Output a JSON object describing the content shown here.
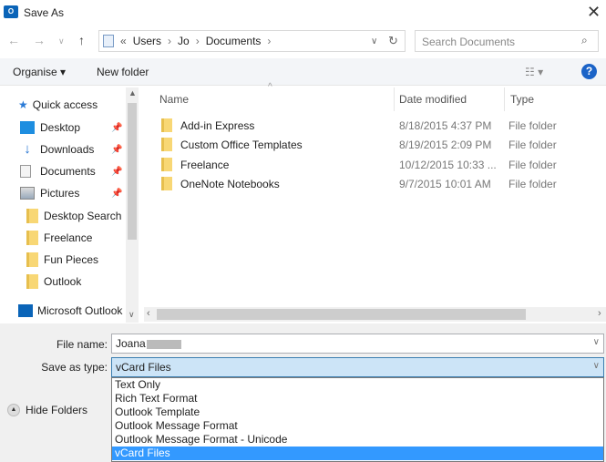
{
  "window": {
    "title": "Save As",
    "app_icon": "O"
  },
  "address": {
    "prefix": "«",
    "crumbs": [
      "Users",
      "Jo",
      "Documents"
    ]
  },
  "search": {
    "placeholder": "Search Documents"
  },
  "toolbar": {
    "organise": "Organise ▾",
    "new_folder": "New folder",
    "help": "?"
  },
  "sidebar": {
    "items": [
      {
        "label": "Quick access",
        "icon": "star-icon"
      },
      {
        "label": "Desktop",
        "icon": "desktop-icon",
        "pinned": true
      },
      {
        "label": "Downloads",
        "icon": "download-icon",
        "pinned": true
      },
      {
        "label": "Documents",
        "icon": "document-icon",
        "pinned": true
      },
      {
        "label": "Pictures",
        "icon": "pictures-icon",
        "pinned": true
      },
      {
        "label": "Desktop Search",
        "icon": "folder-icon"
      },
      {
        "label": "Freelance",
        "icon": "folder-icon"
      },
      {
        "label": "Fun Pieces",
        "icon": "folder-icon"
      },
      {
        "label": "Outlook",
        "icon": "folder-icon"
      },
      {
        "label": "Microsoft Outlook",
        "icon": "outlook-icon"
      }
    ]
  },
  "columns": {
    "name": "Name",
    "date": "Date modified",
    "type": "Type"
  },
  "files": [
    {
      "name": "Add-in Express",
      "date": "8/18/2015 4:37 PM",
      "type": "File folder"
    },
    {
      "name": "Custom Office Templates",
      "date": "8/19/2015 2:09 PM",
      "type": "File folder"
    },
    {
      "name": "Freelance",
      "date": "10/12/2015 10:33 ...",
      "type": "File folder"
    },
    {
      "name": "OneNote Notebooks",
      "date": "9/7/2015 10:01 AM",
      "type": "File folder"
    }
  ],
  "form": {
    "file_name_label": "File name:",
    "file_name_value": "Joana",
    "save_type_label": "Save as type:",
    "save_type_value": "vCard Files"
  },
  "type_options": [
    "Text Only",
    "Rich Text Format",
    "Outlook Template",
    "Outlook Message Format",
    "Outlook Message Format - Unicode",
    "vCard Files"
  ],
  "hide_folders": "Hide Folders",
  "colors": {
    "selection": "#3399ff",
    "accent": "#1b63c7"
  }
}
